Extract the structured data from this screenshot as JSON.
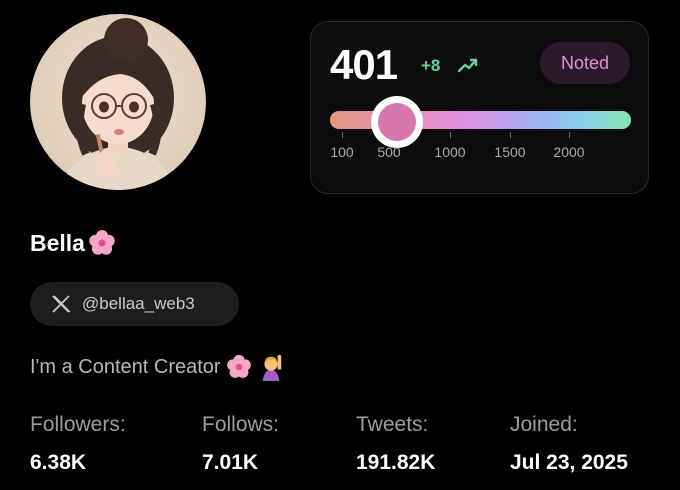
{
  "profile": {
    "display_name": "Bella",
    "handle": "@bellaa_web3",
    "bio": "I'm a Content Creator",
    "avatar_alt": "avatar"
  },
  "score": {
    "value": "401",
    "delta": "+8",
    "badge": "Noted",
    "slider_fraction": 0.13,
    "tick_labels": [
      "100",
      "500",
      "1000",
      "1500",
      "2000"
    ]
  },
  "stats": [
    {
      "label": "Followers:",
      "value": "6.38K"
    },
    {
      "label": "Follows:",
      "value": "7.01K"
    },
    {
      "label": "Tweets:",
      "value": "191.82K"
    },
    {
      "label": "Joined:",
      "value": "Jul 23, 2025"
    }
  ],
  "colors": {
    "background": "#000000",
    "card": "#0c0c0d",
    "delta_green": "#5fd39a",
    "badge_pink": "#e58fd9",
    "thumb_pink": "#d877ad"
  },
  "icons": {
    "trend": "trend-up-icon",
    "x_logo": "x-logo-icon",
    "blossom": "cherry-blossom-emoji",
    "person": "person-raising-hand-emoji"
  }
}
